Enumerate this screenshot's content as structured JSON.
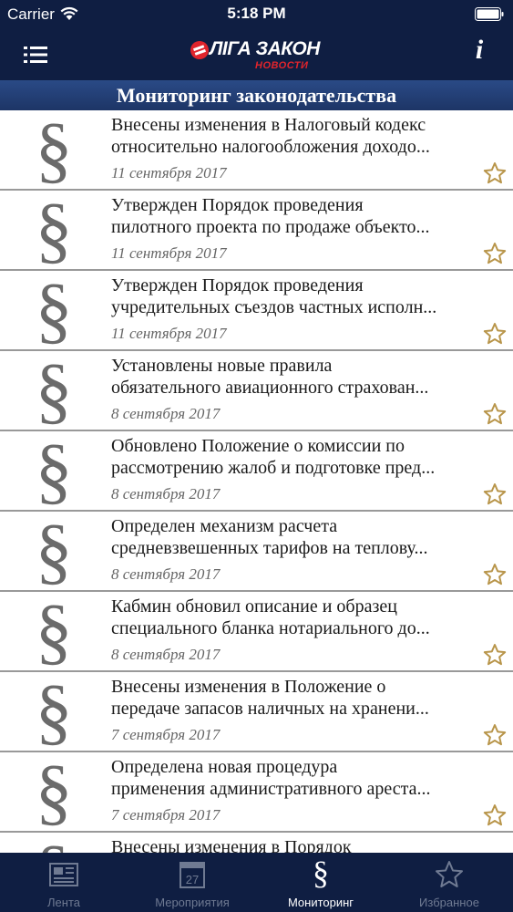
{
  "status_bar": {
    "carrier": "Carrier",
    "time": "5:18 PM"
  },
  "nav": {
    "logo_brand": "ЛIГА ЗАКОН",
    "logo_sub": "НОВОСТИ",
    "info_label": "i"
  },
  "section": {
    "title": "Мониторинг законодательства"
  },
  "items": [
    {
      "title": "Внесены изменения в Налоговый кодекс\nотносительно налогообложения доходо...",
      "date": "11 сентября 2017"
    },
    {
      "title": "Утвержден Порядок проведения\nпилотного проекта по продаже объекто...",
      "date": "11 сентября 2017"
    },
    {
      "title": "Утвержден Порядок проведения\nучредительных съездов частных исполн...",
      "date": "11 сентября 2017"
    },
    {
      "title": "Установлены новые правила\nобязательного авиационного страхован...",
      "date": "8 сентября 2017"
    },
    {
      "title": "Обновлено Положение о комиссии по\nрассмотрению жалоб и подготовке пред...",
      "date": "8 сентября 2017"
    },
    {
      "title": "Определен механизм расчета\nсредневзвешенных тарифов на теплову...",
      "date": "8 сентября 2017"
    },
    {
      "title": "Кабмин обновил описание и образец\nспециального бланка нотариального до...",
      "date": "8 сентября 2017"
    },
    {
      "title": "Внесены изменения в Положение о\nпередаче запасов наличных на хранени...",
      "date": "7 сентября 2017"
    },
    {
      "title": "Определена новая процедура\nприменения административного ареста...",
      "date": "7 сентября 2017"
    },
    {
      "title": "Внесены изменения в Порядок",
      "date": ""
    }
  ],
  "section_symbol": "§",
  "tabs": [
    {
      "label": "Лента",
      "icon": "newspaper-icon"
    },
    {
      "label": "Мероприятия",
      "icon": "calendar-icon",
      "calendar_day": "27"
    },
    {
      "label": "Мониторинг",
      "icon": "section-sign-icon",
      "glyph": "§"
    },
    {
      "label": "Избранное",
      "icon": "star-icon"
    }
  ],
  "colors": {
    "nav_background": "#0f1e42",
    "header_background": "#1d3566",
    "accent_star": "#b8954a",
    "tab_inactive": "#6f7a92",
    "logo_red": "#e0242c"
  }
}
